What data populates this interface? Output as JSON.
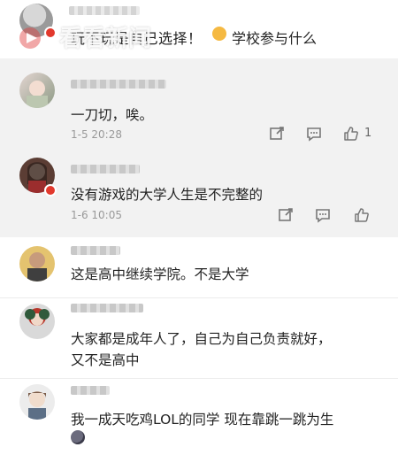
{
  "top_comment": {
    "text_a": "玩不玩是自己选择！",
    "text_b": "学校参与什么",
    "watermark": "看看新闻"
  },
  "thread": {
    "replies": [
      {
        "text": "一刀切，唉。",
        "time": "1-5 20:28",
        "likes": "1"
      },
      {
        "text": "没有游戏的大学人生是不完整的",
        "time": "1-6 10:05",
        "likes": ""
      }
    ]
  },
  "comments": [
    {
      "text": "这是高中继续学院。不是大学"
    },
    {
      "text_line1": "大家都是成年人了，自己为自己负责就好，",
      "text_line2": "又不是高中"
    },
    {
      "text": "我一成天吃鸡LOL的同学 现在靠跳一跳为生"
    }
  ],
  "colors": {
    "thread_bg": "#f2f2f2",
    "muted": "#999999",
    "badge": "#e2392d"
  },
  "icons": [
    "share-icon",
    "comment-icon",
    "like-icon",
    "emoji-icon",
    "watermark-logo-icon"
  ]
}
